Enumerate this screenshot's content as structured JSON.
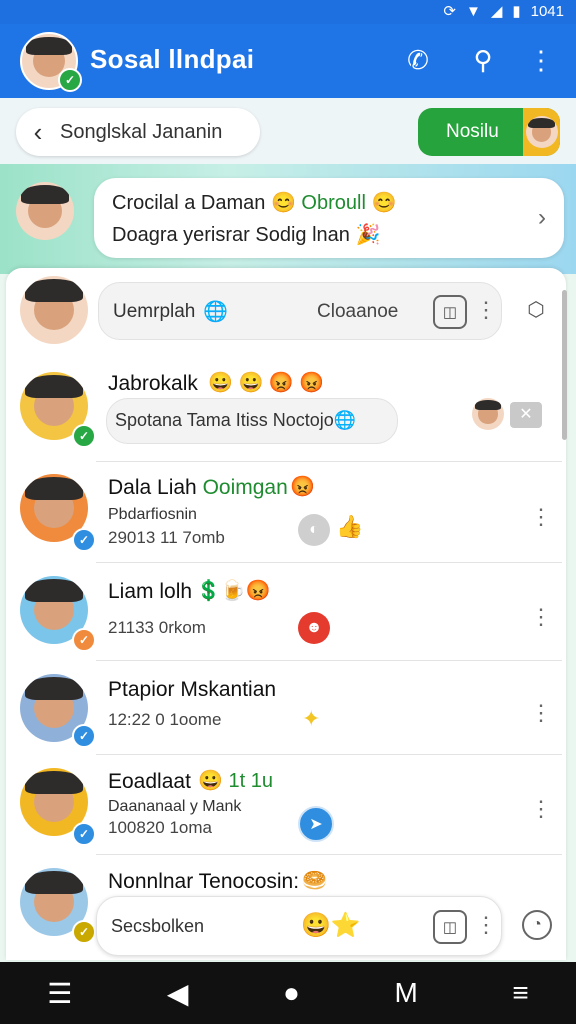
{
  "status_bar": {
    "time": "1041"
  },
  "app": {
    "title": "Sosal llndpai",
    "accent": "#1f74e6"
  },
  "subbar": {
    "back_label": "Songlskal Jananin",
    "action_label": "Nosilu"
  },
  "banner": {
    "line1_a": "Crocilal a Daman 😊",
    "line1_b": "Obroull",
    "line1_c": "😊",
    "line2": "Doagra yerisrar Sodig lnan 🎉"
  },
  "search": {
    "placeholder": "Uemrplah",
    "right_label": "Cloaanoe"
  },
  "chats": [
    {
      "name": "Jabrokalk",
      "emojis": "😀 😀 😡 😡",
      "preview": "Spotana Tama Itiss Noctojo🌐"
    },
    {
      "name_a": "Dala Liah",
      "name_b": "Ooimgan",
      "emojis": "😡",
      "sub": "Pbdarfiosnin",
      "time": "29013 11 7omb"
    },
    {
      "name": "Liam lolh",
      "emojis": "💲🍺😡",
      "time": "21133 0rkom"
    },
    {
      "name": "Ptapior Mskantian",
      "time": "12:22 0 1oome"
    },
    {
      "name": "Eoadlaat",
      "emojis": "😀 1t 1u",
      "sub": "Daananaal y Mank",
      "time": "100820 1oma"
    },
    {
      "name": "Nonnlnar Tenocosin:",
      "emojis": "🥯"
    }
  ],
  "composer": {
    "placeholder": "Secsbolken",
    "emojis": "😀⭐"
  }
}
